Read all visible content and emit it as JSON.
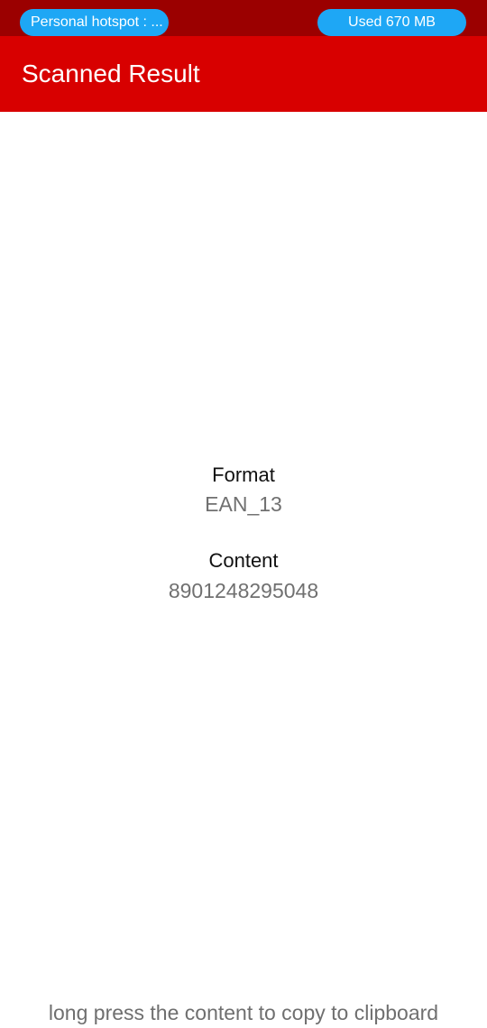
{
  "status_bar": {
    "hotspot_label": "Personal hotspot : ...",
    "data_usage_label": "Used  670 MB",
    "background": "#9b0000",
    "pill_color": "#1ea7f5"
  },
  "app_bar": {
    "title": "Scanned Result",
    "background": "#d80000"
  },
  "result": {
    "format_label": "Format",
    "format_value": "EAN_13",
    "content_label": "Content",
    "content_value": "8901248295048"
  },
  "footer": {
    "hint": "long press the content to copy to clipboard"
  }
}
